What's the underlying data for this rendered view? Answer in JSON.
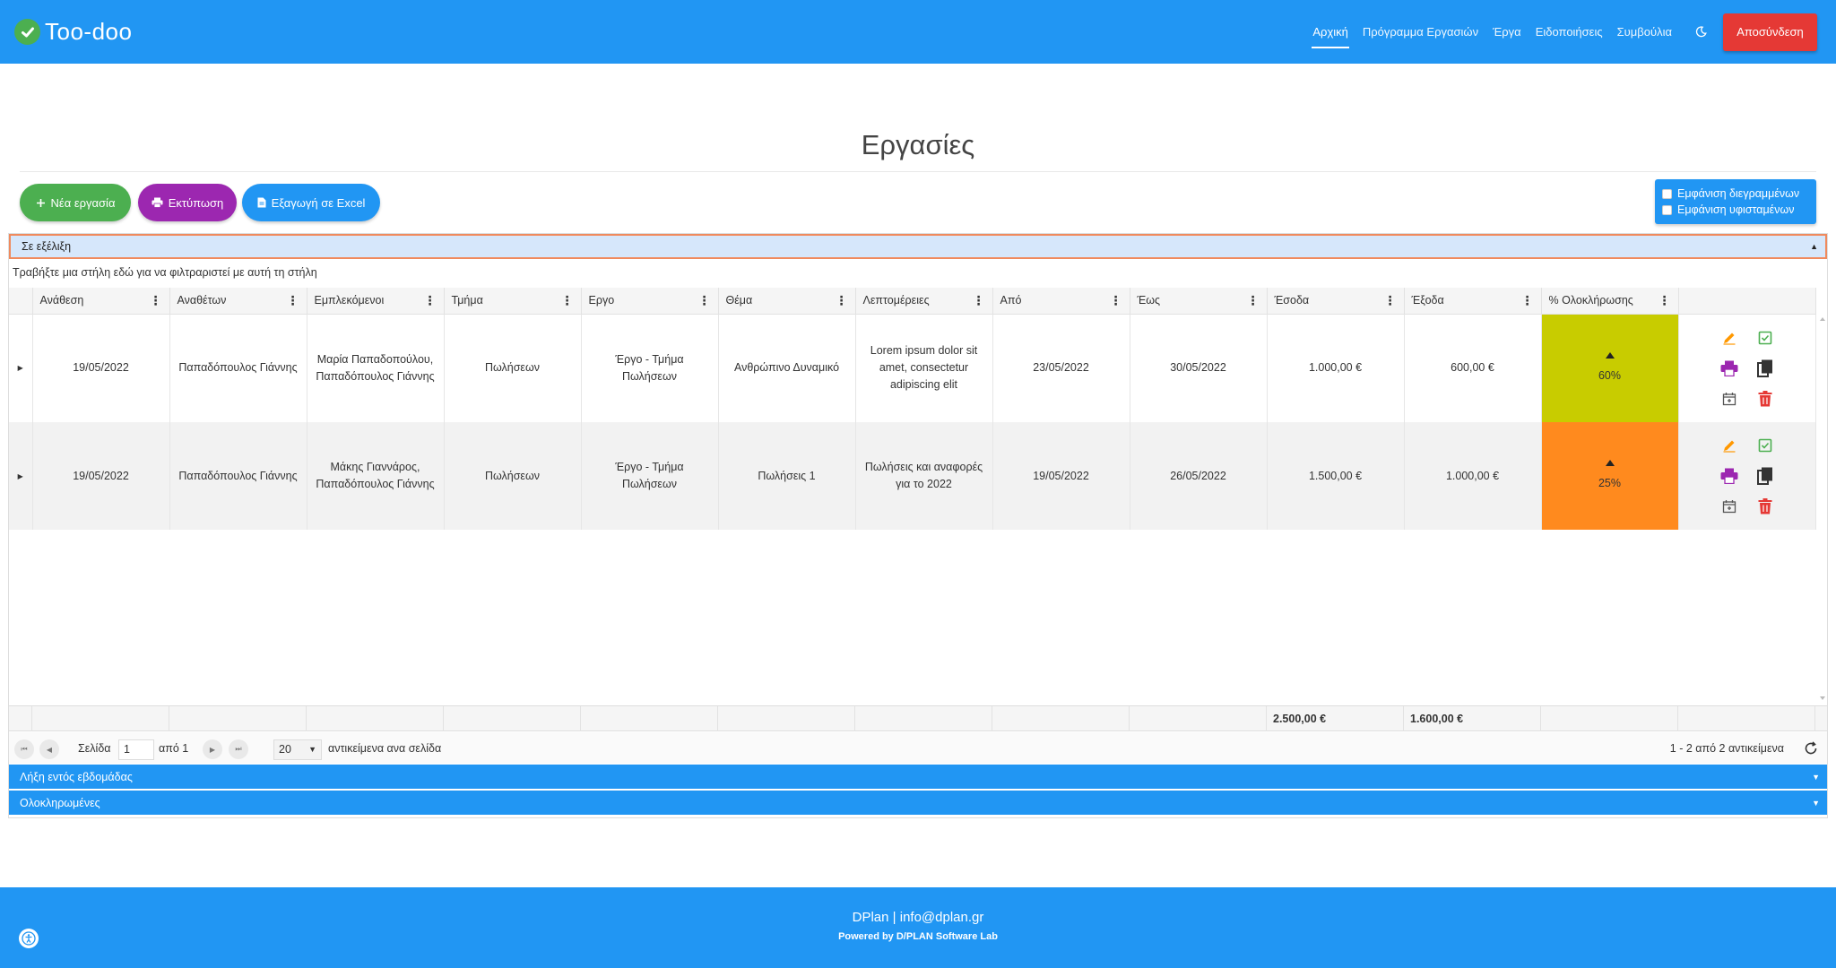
{
  "brand": {
    "name": "Too-doo"
  },
  "nav": {
    "items": [
      {
        "label": "Αρχική"
      },
      {
        "label": "Πρόγραμμα Εργασιών"
      },
      {
        "label": "Έργα"
      },
      {
        "label": "Ειδοποιήσεις"
      },
      {
        "label": "Συμβούλια"
      }
    ],
    "logout": "Αποσύνδεση"
  },
  "page": {
    "title": "Εργασίες"
  },
  "actions": {
    "new_task": "Νέα εργασία",
    "print": "Εκτύπωση",
    "export": "Εξαγωγή σε Excel"
  },
  "options": {
    "show_deleted": "Εμφάνιση διεγραμμένων",
    "show_subtasks": "Εμφάνιση υφισταμένων"
  },
  "groups": {
    "in_progress": "Σε εξέλιξη",
    "due_week": "Λήξη εντός εβδομάδας",
    "completed": "Ολοκληρωμένες"
  },
  "grid": {
    "drag_hint": "Τραβήξτε μια στήλη εδώ για να φιλτραριστεί με αυτή τη στήλη",
    "columns": [
      "Ανάθεση",
      "Αναθέτων",
      "Εμπλεκόμενοι",
      "Τμήμα",
      "Εργο",
      "Θέμα",
      "Λεπτομέρειες",
      "Από",
      "Έως",
      "Έσοδα",
      "Έξοδα",
      "% Ολοκλήρωσης"
    ],
    "rows": [
      {
        "assigned": "19/05/2022",
        "assigner": "Παπαδόπουλος Γιάννης",
        "involved": "Μαρία Παπαδοπούλου, Παπαδόπουλος Γιάννης",
        "department": "Πωλήσεων",
        "project": "Έργο - Τμήμα Πωλήσεων",
        "subject": "Ανθρώπινο Δυναμικό",
        "details": "Lorem ipsum dolor sit amet, consectetur adipiscing elit",
        "from": "23/05/2022",
        "to": "30/05/2022",
        "income": "1.000,00 €",
        "expenses": "600,00 €",
        "completion": "60%",
        "completion_value": 60,
        "completion_color": "#c8cc00"
      },
      {
        "assigned": "19/05/2022",
        "assigner": "Παπαδόπουλος Γιάννης",
        "involved": "Μάκης Γιαννάρος, Παπαδόπουλος Γιάννης",
        "department": "Πωλήσεων",
        "project": "Έργο - Τμήμα Πωλήσεων",
        "subject": "Πωλήσεις 1",
        "details": "Πωλήσεις και αναφορές για το 2022",
        "from": "19/05/2022",
        "to": "26/05/2022",
        "income": "1.500,00 €",
        "expenses": "1.000,00 €",
        "completion": "25%",
        "completion_value": 25,
        "completion_color": "#ff8a1e"
      }
    ],
    "totals": {
      "income": "2.500,00 €",
      "expenses": "1.600,00 €"
    }
  },
  "pager": {
    "page_label": "Σελίδα",
    "page_value": "1",
    "of_label": "από 1",
    "page_size": "20",
    "per_page_label": "αντικείμενα ανα σελίδα",
    "summary": "1 - 2 από 2 αντικείμενα"
  },
  "footer": {
    "company": "DPlan",
    "email": "info@dplan.gr",
    "powered": "Powered by D/PLAN Software Lab"
  },
  "colors": {
    "primary": "#2196f3",
    "success": "#4caf50",
    "purple": "#9c27b0",
    "danger": "#e53935",
    "edit": "#ff9800"
  },
  "icons": [
    "check-circle-icon",
    "moon-icon",
    "plus-icon",
    "printer-icon",
    "file-icon",
    "pencil-icon",
    "checkbox-icon",
    "copy-icon",
    "calendar-icon",
    "trash-icon",
    "refresh-icon",
    "accessibility-icon"
  ]
}
